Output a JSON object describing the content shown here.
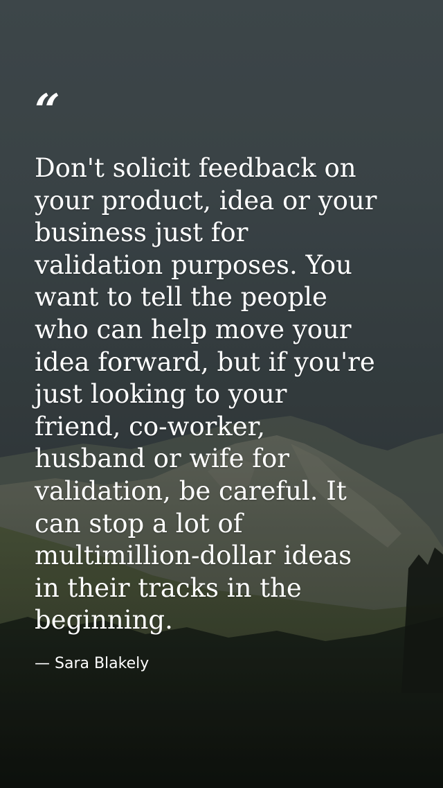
{
  "quote": {
    "mark": "“",
    "text": "Don't solicit feedback on\nyour product, idea or your\nbusiness just for\nvalidation purposes. You\nwant to tell the people\nwho can help move your\nidea forward, but if you're\njust looking to your\nfriend, co-worker,\nhusband or wife for\nvalidation, be careful. It\ncan stop a lot of\nmultimillion-dollar ideas\nin their tracks in the\nbeginning.",
    "author": "— Sara Blakely"
  },
  "background": {
    "scene": "mountain-landscape",
    "sky_color": "#4b5659",
    "mountain_color": "#5f675c",
    "forest_color": "#1a2119"
  }
}
